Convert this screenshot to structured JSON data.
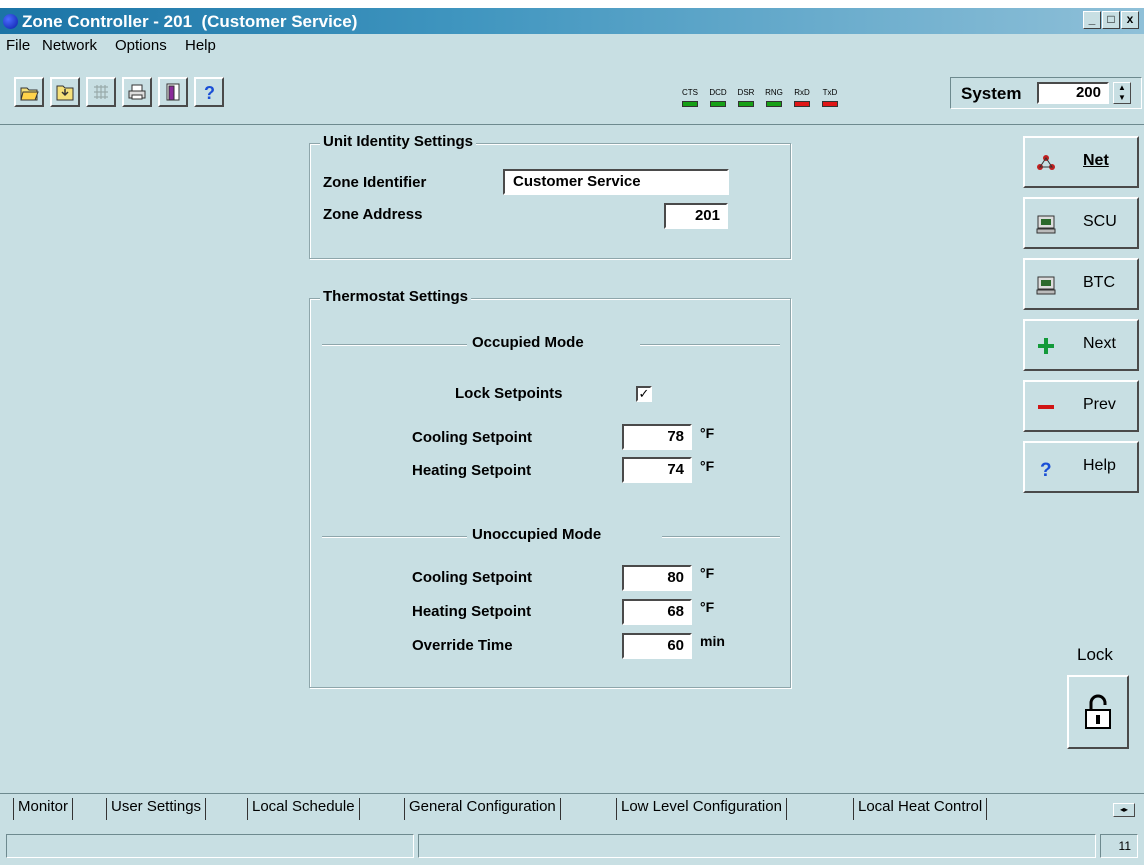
{
  "window": {
    "title": "Zone Controller - 201  (Customer Service)",
    "minimize": "_",
    "maximize": "□",
    "close": "x"
  },
  "menu": [
    "File",
    "Network",
    "Options",
    "Help"
  ],
  "toolbar": {
    "buttons": [
      "open-icon",
      "save-icon",
      "network-grid-icon",
      "print-icon",
      "exit-icon",
      "help-icon"
    ],
    "leds": [
      {
        "label": "CTS",
        "color": "#17a017"
      },
      {
        "label": "DCD",
        "color": "#17a017"
      },
      {
        "label": "DSR",
        "color": "#17a017"
      },
      {
        "label": "RNG",
        "color": "#17a017"
      },
      {
        "label": "RxD",
        "color": "#e01616"
      },
      {
        "label": "TxD",
        "color": "#e01616"
      }
    ],
    "system_label": "System",
    "system_value": "200"
  },
  "identity": {
    "title": "Unit Identity Settings",
    "zone_identifier_label": "Zone Identifier",
    "zone_identifier_value": "Customer Service",
    "zone_address_label": "Zone Address",
    "zone_address_value": "201"
  },
  "thermostat": {
    "title": "Thermostat Settings",
    "occupied": {
      "title": "Occupied Mode",
      "lock_label": "Lock Setpoints",
      "lock_checked": "✓",
      "cooling_label": "Cooling Setpoint",
      "cooling_value": "78",
      "heating_label": "Heating Setpoint",
      "heating_value": "74",
      "unit": "°F"
    },
    "unoccupied": {
      "title": "Unoccupied Mode",
      "cooling_label": "Cooling Setpoint",
      "cooling_value": "80",
      "heating_label": "Heating Setpoint",
      "heating_value": "68",
      "override_label": "Override Time",
      "override_value": "60",
      "override_unit": "min",
      "unit": "°F"
    }
  },
  "side_buttons": [
    {
      "label": "Net",
      "icon": "network-icon"
    },
    {
      "label": "SCU",
      "icon": "computer-icon"
    },
    {
      "label": "BTC",
      "icon": "computer-icon"
    },
    {
      "label": "Next",
      "icon": "plus-icon"
    },
    {
      "label": "Prev",
      "icon": "minus-icon"
    },
    {
      "label": "Help",
      "icon": "question-icon"
    }
  ],
  "lock": {
    "label": "Lock",
    "icon": "padlock-icon"
  },
  "tabs": [
    "Monitor",
    "User Settings",
    "Local Schedule",
    "General Configuration",
    "Low Level Configuration",
    "Local Heat Control"
  ],
  "active_tab": "User Settings",
  "status": {
    "pane3": "11"
  }
}
